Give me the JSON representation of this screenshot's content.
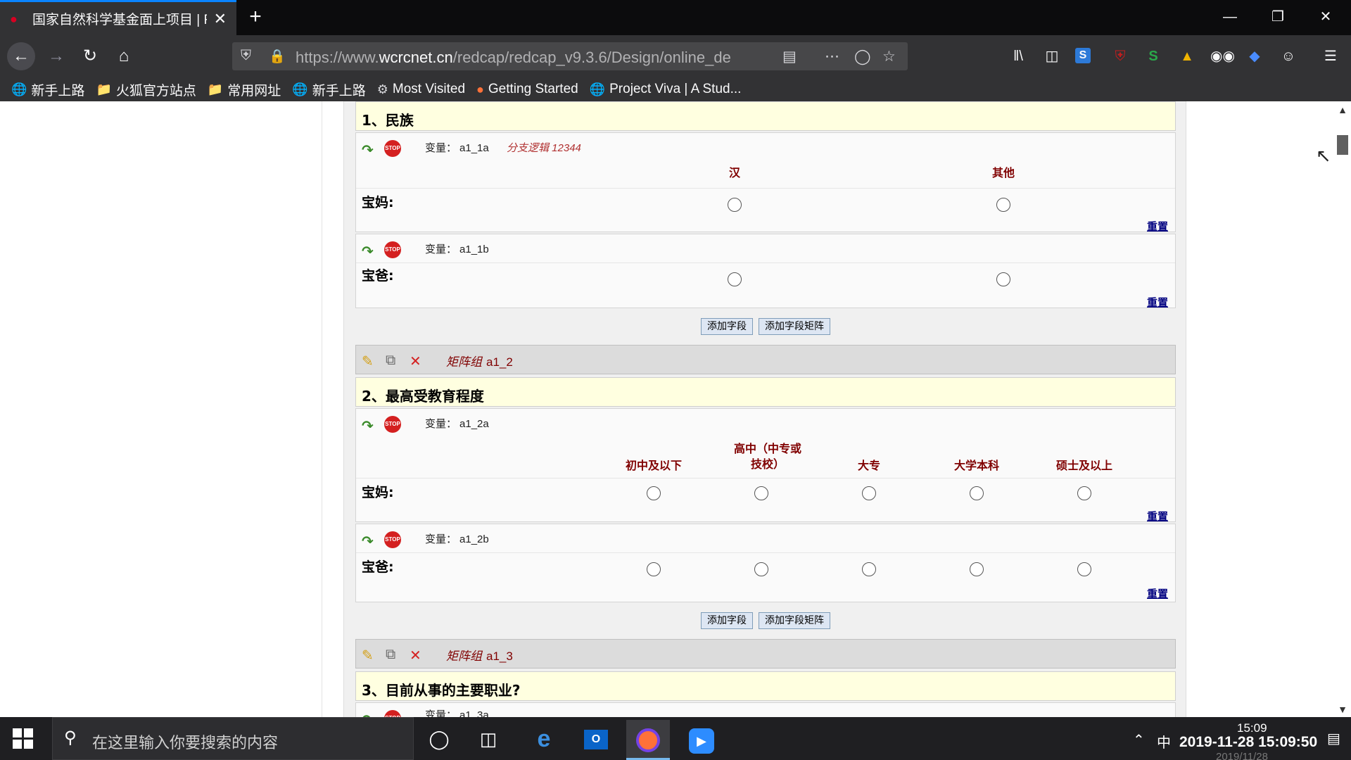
{
  "browser": {
    "tab_title": "国家自然科学基金面上项目 | R",
    "url_prefix": "https://www.",
    "url_domain": "wcrcnet.cn",
    "url_path": "/redcap/redcap_v9.3.6/Design/online_de",
    "bookmarks": [
      {
        "label": "新手上路",
        "icon": "globe-icon"
      },
      {
        "label": "火狐官方站点",
        "icon": "folder-icon"
      },
      {
        "label": "常用网址",
        "icon": "folder-icon"
      },
      {
        "label": "新手上路",
        "icon": "globe-icon"
      },
      {
        "label": "Most Visited",
        "icon": "gear-icon"
      },
      {
        "label": "Getting Started",
        "icon": "firefox-icon"
      },
      {
        "label": "Project Viva | A Stud...",
        "icon": "globe-icon"
      }
    ]
  },
  "form": {
    "var_prefix": "变量：",
    "reset_label": "重置",
    "add_field_label": "添加字段",
    "add_matrix_label": "添加字段矩阵",
    "matrix_group_label": "矩阵组",
    "section1": {
      "title": "1、民族",
      "columns": [
        "汉",
        "其他"
      ],
      "rows": [
        {
          "var": "a1_1a",
          "label": "宝妈:",
          "branch": "分支逻辑 12344"
        },
        {
          "var": "a1_1b",
          "label": "宝爸:"
        }
      ]
    },
    "matrix2": "a1_2",
    "section2": {
      "title": "2、最高受教育程度",
      "columns": [
        "初中及以下",
        "高中（中专或技校）",
        "大专",
        "大学本科",
        "硕士及以上"
      ],
      "rows": [
        {
          "var": "a1_2a",
          "label": "宝妈:"
        },
        {
          "var": "a1_2b",
          "label": "宝爸:"
        }
      ]
    },
    "matrix3": "a1_3",
    "section3": {
      "title": "3、目前从事的主要职业?",
      "next_var": "a1_3a"
    }
  },
  "taskbar": {
    "search_placeholder": "在这里输入你要搜索的内容",
    "ime": "中",
    "time_small": "15:09",
    "clock_overlay": "2019-11-28  15:09:50",
    "date_ghost": "2019/11/28"
  }
}
